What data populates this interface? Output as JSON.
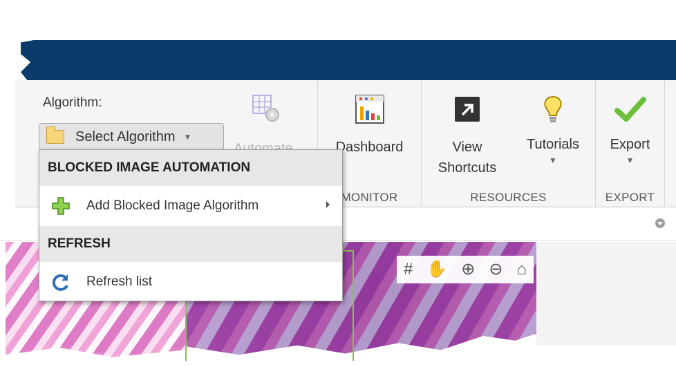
{
  "toolstrip": {
    "algorithm_label": "Algorithm:",
    "select_button_label": "Select Algorithm",
    "automate_label": "Automate",
    "dashboard_label": "Dashboard",
    "monitor_section": "MONITOR",
    "view_shortcuts_label_line1": "View",
    "view_shortcuts_label_line2": "Shortcuts",
    "tutorials_label": "Tutorials",
    "resources_section": "RESOURCES",
    "export_label": "Export",
    "export_section": "EXPORT"
  },
  "dropdown": {
    "header_automation": "BLOCKED IMAGE AUTOMATION",
    "add_item_label": "Add Blocked Image Algorithm",
    "header_refresh": "REFRESH",
    "refresh_item_label": "Refresh list"
  },
  "axes_toolbar": {
    "icons": [
      "datatip-icon",
      "pan-icon",
      "zoom-in-icon",
      "zoom-out-icon",
      "home-icon"
    ]
  },
  "colors": {
    "title_band": "#0b3b6b",
    "dropdown_header_bg": "#e7e7e7",
    "roi_border": "#88c057",
    "export_check": "#6bbf3a"
  }
}
